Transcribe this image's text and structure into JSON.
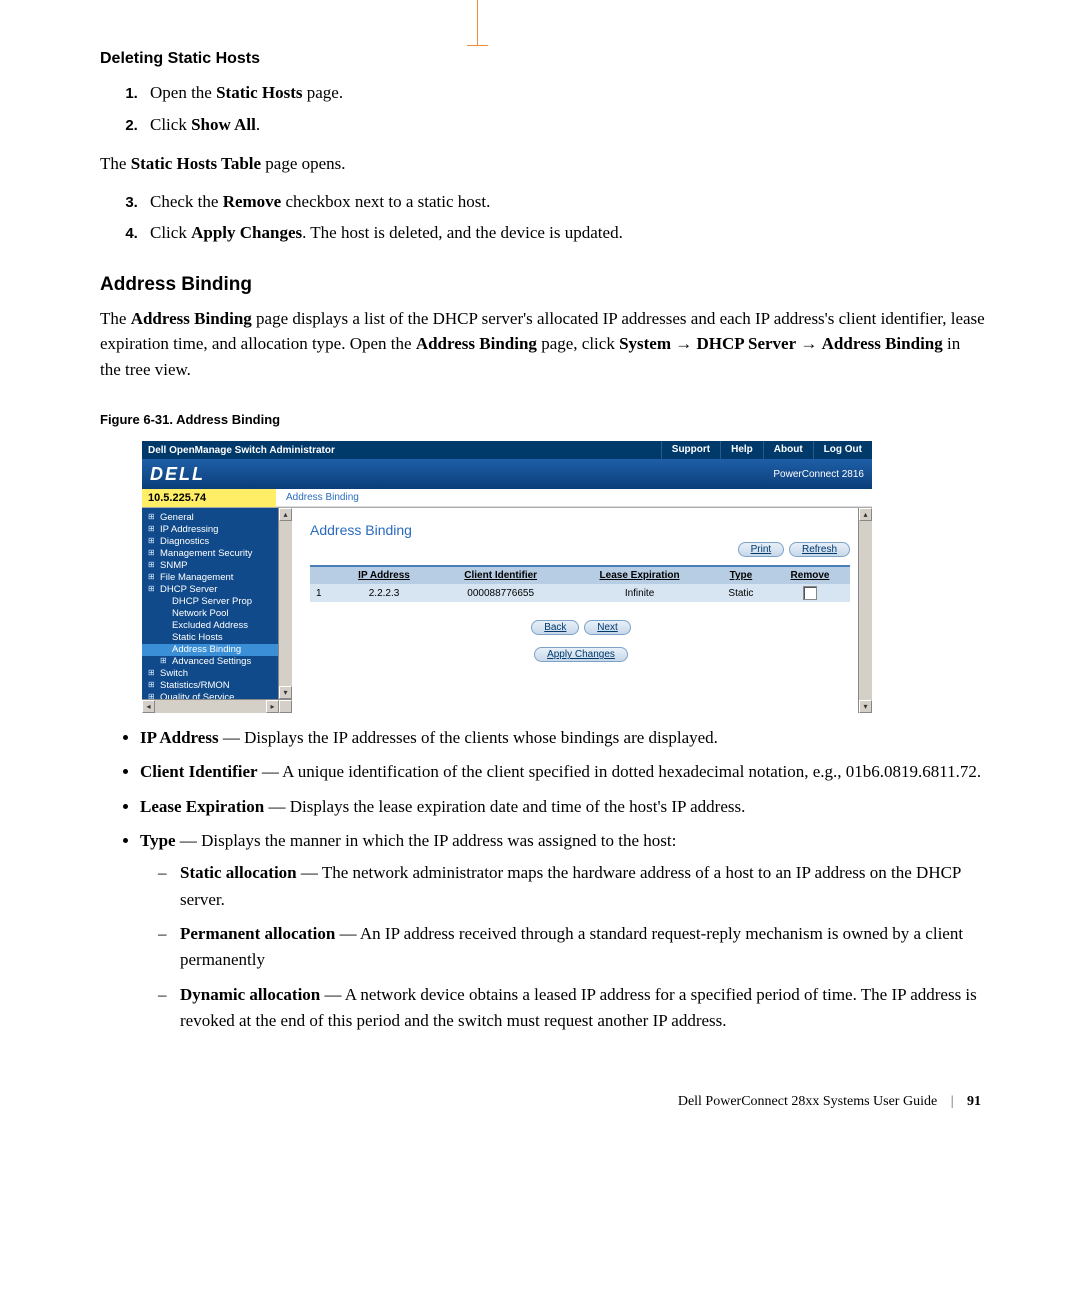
{
  "section_mini": "Deleting Static Hosts",
  "steps_a": {
    "s1_pre": "Open the ",
    "s1_b": "Static Hosts",
    "s1_post": " page.",
    "s2_pre": "Click ",
    "s2_b": "Show All",
    "s2_post": "."
  },
  "mid_para": {
    "pre": "The ",
    "b": "Static Hosts Table",
    "post": " page opens."
  },
  "steps_b": {
    "s3_pre": "Check the ",
    "s3_b": "Remove",
    "s3_post": " checkbox next to a static host.",
    "s4_pre": "Click ",
    "s4_b": "Apply Changes",
    "s4_post": ". The host is deleted, and the device is updated."
  },
  "section": "Address Binding",
  "intro": {
    "t1": "The ",
    "b1": "Address Binding",
    "t2": " page displays a list of the DHCP server's allocated IP addresses and each IP address's client identifier, lease expiration time, and allocation type. Open the ",
    "b2": "Address Binding",
    "t3": " page, click ",
    "b3": "System",
    "arr1": " → ",
    "b4": "DHCP Server",
    "arr2": " → ",
    "b5": "Address Binding",
    "t4": " in the tree view."
  },
  "figcap": "Figure 6-31.    Address Binding",
  "screenshot": {
    "titlebar": {
      "title": "Dell OpenManage Switch Administrator",
      "support": "Support",
      "help": "Help",
      "about": "About",
      "logout": "Log Out"
    },
    "brand": {
      "logo": "DELL",
      "model": "PowerConnect 2816"
    },
    "ip": "10.5.225.74",
    "breadcrumb": "Address Binding",
    "tree": {
      "general": "General",
      "ipaddr": "IP Addressing",
      "diag": "Diagnostics",
      "mgmt": "Management Security",
      "snmp": "SNMP",
      "filem": "File Management",
      "dhcp": "DHCP Server",
      "dhcp_prop": "DHCP Server Prop",
      "netpool": "Network Pool",
      "excl": "Excluded Address",
      "statichosts": "Static Hosts",
      "addrbind": "Address Binding",
      "adv": "Advanced Settings",
      "switch": "Switch",
      "stats": "Statistics/RMON",
      "qos": "Quality of Service"
    },
    "content": {
      "title": "Address Binding",
      "print": "Print",
      "refresh": "Refresh",
      "headers": {
        "ip": "IP Address",
        "cid": "Client Identifier",
        "lease": "Lease Expiration",
        "type": "Type",
        "remove": "Remove"
      },
      "row": {
        "n": "1",
        "ip": "2.2.2.3",
        "cid": "000088776655",
        "lease": "Infinite",
        "type": "Static"
      },
      "back": "Back",
      "next": "Next",
      "apply": "Apply Changes"
    }
  },
  "bullets": {
    "ip_b": "IP Address",
    "ip_t": " — Displays the IP addresses of the clients whose bindings are displayed.",
    "cid_b": "Client Identifier",
    "cid_t": " — A unique identification of the client specified in dotted hexadecimal notation, e.g., 01b6.0819.6811.72.",
    "lease_b": "Lease Expiration",
    "lease_t": " — Displays the lease expiration date and time of the host's IP address.",
    "type_b": "Type",
    "type_t": " — Displays the manner in which the IP address was assigned to the host:",
    "static_b": "Static allocation",
    "static_t": " — The network administrator maps the hardware address of a host to an IP address on the DHCP server.",
    "perm_b": "Permanent allocation",
    "perm_t": " — An IP address received through a standard request-reply mechanism is owned by a client permanently",
    "dyn_b": "Dynamic allocation",
    "dyn_t": " — A network device obtains a leased IP address for a specified period of time. The IP address is revoked at the end of this period and the switch must request another IP address."
  },
  "footer": {
    "guide": "Dell PowerConnect 28xx Systems User Guide",
    "sep": "|",
    "pn": "91"
  }
}
